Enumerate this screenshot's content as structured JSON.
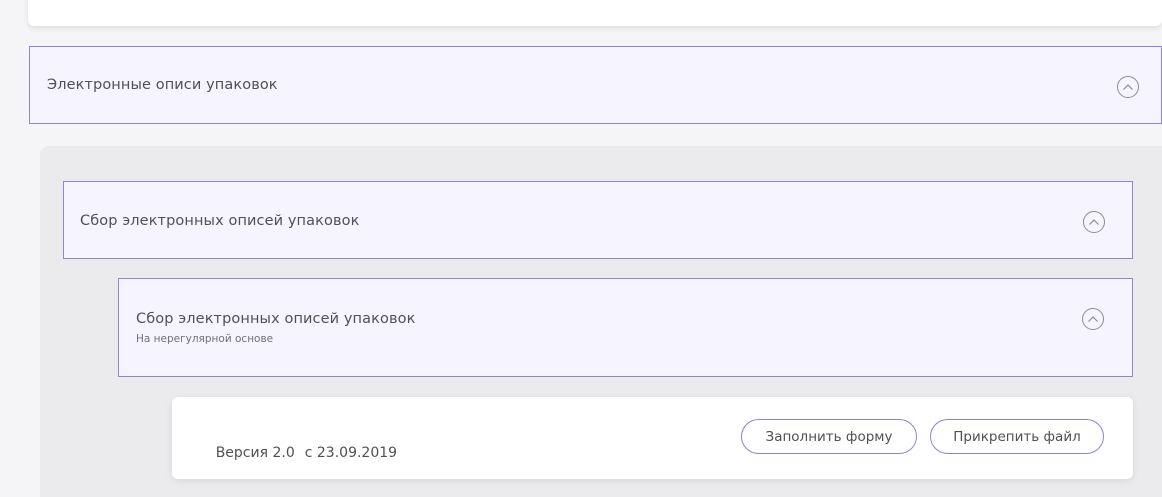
{
  "sections": {
    "outer": {
      "title": "Электронные описи упаковок",
      "toggle_icon": "chevron-up-circle-icon"
    },
    "group": {
      "title": "Сбор электронных описей упаковок",
      "toggle_icon": "chevron-up-circle-icon"
    },
    "form": {
      "title": "Сбор электронных описей упаковок",
      "subtitle": "На нерегулярной основе",
      "toggle_icon": "chevron-up-circle-icon"
    }
  },
  "version": {
    "label": "Версия 2.0",
    "date": "с 23.09.2019",
    "fill_button": "Заполнить форму",
    "attach_button": "Прикрепить файл"
  },
  "colors": {
    "accent_border": "#8f83d2",
    "panel_bg": "#f6f4ff",
    "group_bg": "#ebebed"
  }
}
